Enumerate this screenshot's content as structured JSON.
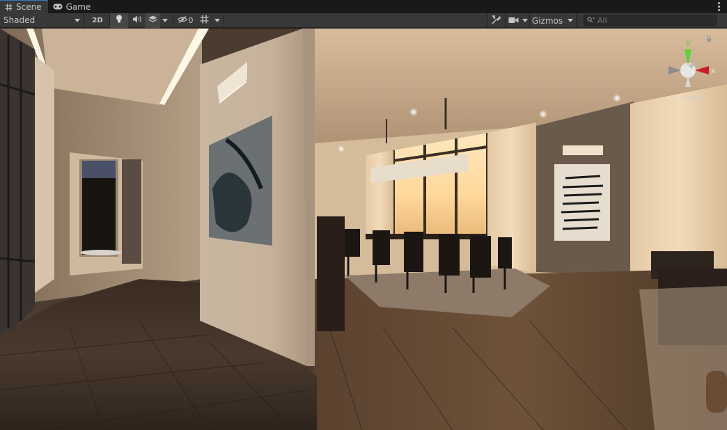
{
  "tabs": [
    {
      "label": "Scene",
      "icon": "hash-icon",
      "active": true
    },
    {
      "label": "Game",
      "icon": "gamepad-icon",
      "active": false
    }
  ],
  "toolbar": {
    "shading_mode": "Shaded",
    "mode_2d_label": "2D",
    "hidden_count": "0",
    "gizmos_label": "Gizmos",
    "search_placeholder": "All"
  },
  "viewport": {
    "projection_label": "Persp",
    "axis_labels": {
      "x": "x",
      "y": "y"
    }
  },
  "colors": {
    "panel_bg": "#383838",
    "tabbar_bg": "#191919",
    "active_tab_accent": "#3a79bb",
    "text": "#c4c4c4",
    "gizmo_x": "#c8202a",
    "gizmo_y": "#5bd33b"
  }
}
